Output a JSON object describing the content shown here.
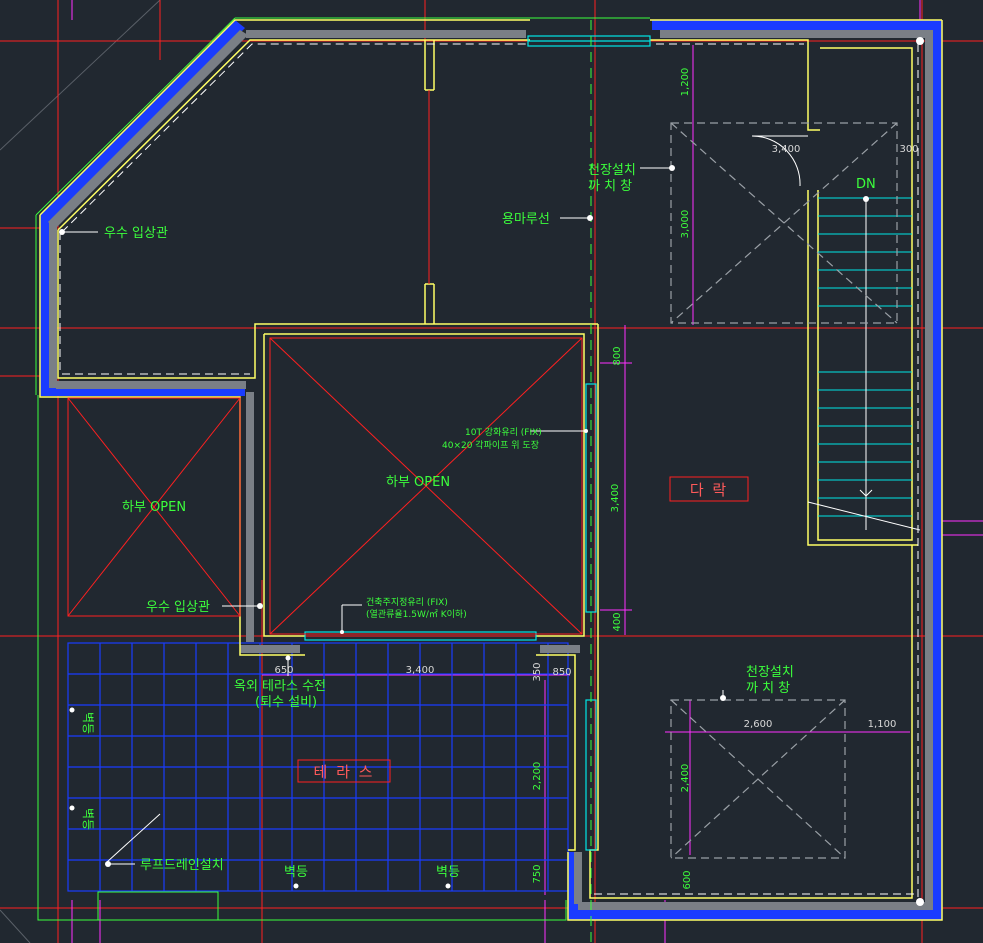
{
  "labels": {
    "rain_pipe_top": "우수 입상관",
    "rain_pipe_mid": "우수 입상관",
    "ridge_line": "용마루선",
    "skylight_top": "천장설치\n까 치 창",
    "skylight_bottom": "천장설치\n까 치 창",
    "open_left": "하부 OPEN",
    "open_center": "하부 OPEN",
    "glass_right_1": "10T 강화유리 (FIX)",
    "glass_right_2": "40×20 각파이프 위 도장",
    "glass_bottom_1": "건축주지정유리 (FIX)",
    "glass_bottom_2": "(열관류율1.5W/㎡ K이하)",
    "faucet_1": "옥외 테라스 수전",
    "faucet_2": "(퇴수 설비)",
    "roof_drain": "루프드레인설치",
    "wall_lamp_1": "벽등",
    "wall_lamp_2": "벽등",
    "light_1": "벽등",
    "light_2": "벽등",
    "stair_dn": "DN"
  },
  "rooms": {
    "terrace": "테 라 스",
    "attic": "다 락"
  },
  "dimensions": {
    "d_1200": "1,200",
    "d_3400_top": "3,400",
    "d_300": "300",
    "d_3000": "3,000",
    "d_800": "800",
    "d_3400_v": "3,400",
    "d_400": "400",
    "d_650": "650",
    "d_3400_h": "3,400",
    "d_850": "850",
    "d_2200": "2,200",
    "d_750": "750",
    "d_2600": "2,600",
    "d_1100": "1,100",
    "d_2400": "2,400",
    "d_600": "600",
    "d_350": "350"
  },
  "colors": {
    "background": "#212830",
    "wall_outline": "#ffff66",
    "insulation": "#1a3cff",
    "grid_red": "#ff2020",
    "text_green": "#3cff3c",
    "cyan": "#00e6e6",
    "magenta": "#ff30ff"
  }
}
